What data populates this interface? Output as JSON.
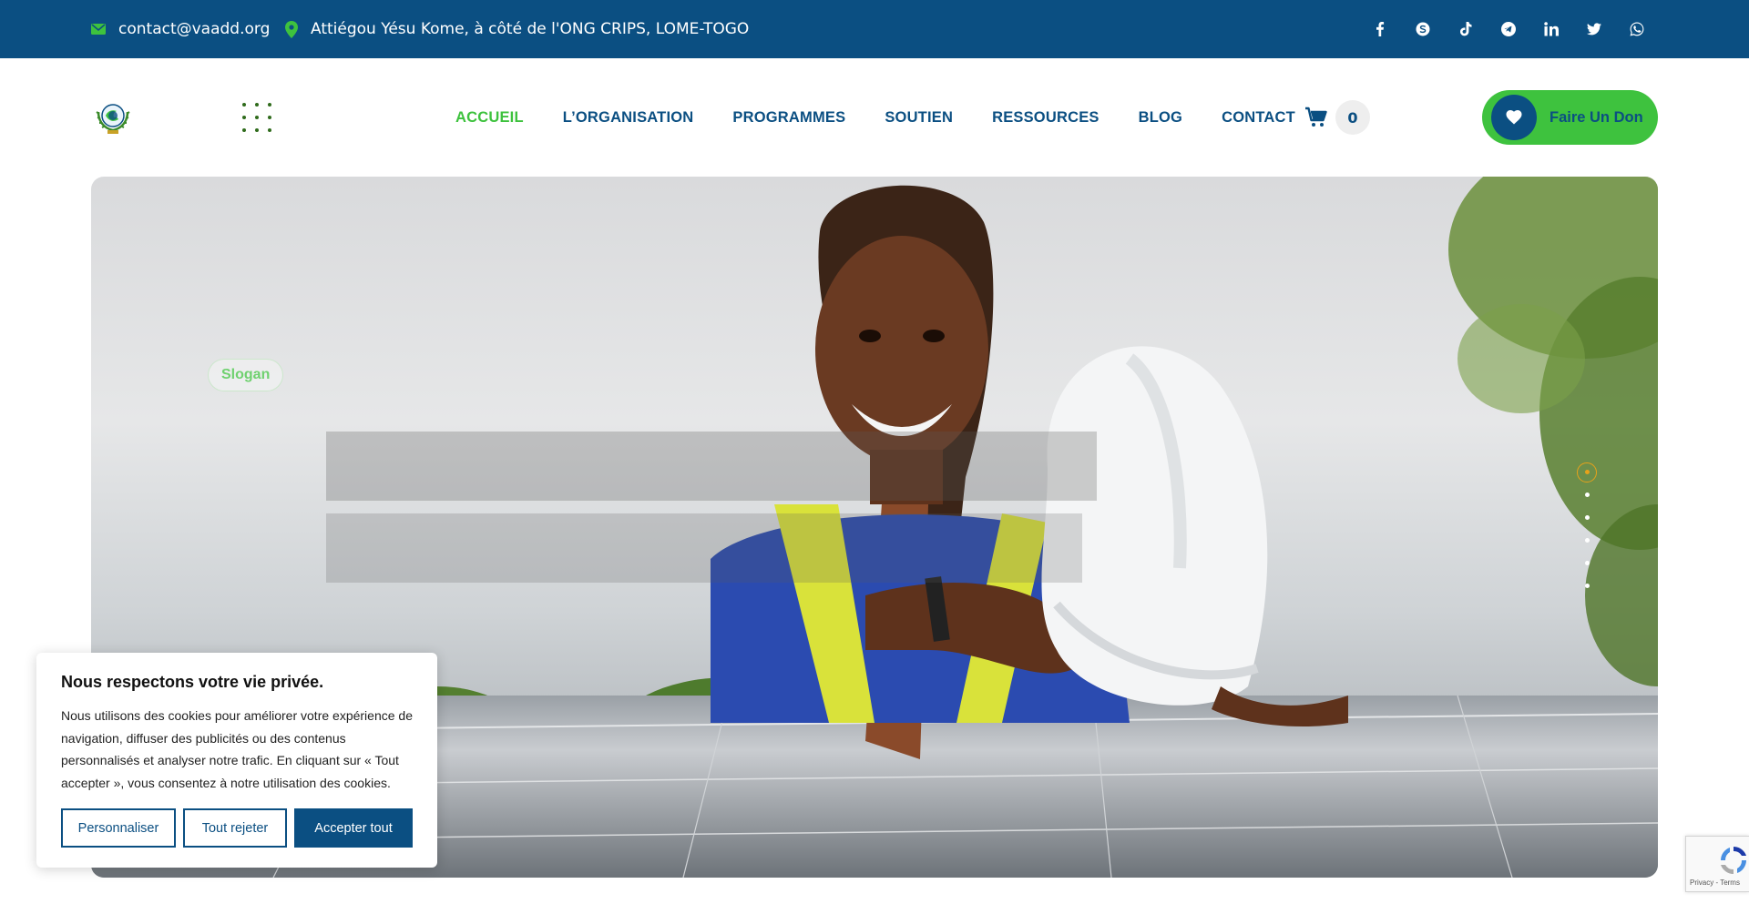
{
  "topbar": {
    "email": "contact@vaadd.org",
    "address": "Attiégou Yésu Kome, à côté de l'ONG CRIPS, LOME-TOGO",
    "socials": [
      "facebook-icon",
      "skype-icon",
      "tiktok-icon",
      "telegram-icon",
      "linkedin-icon",
      "twitter-icon",
      "whatsapp-icon"
    ]
  },
  "header": {
    "nav": [
      "ACCUEIL",
      "L’ORGANISATION",
      "PROGRAMMES",
      "SOUTIEN",
      "RESSOURCES",
      "BLOG",
      "CONTACT"
    ],
    "active_nav": "ACCUEIL",
    "cart_count": "0",
    "donate_label": "Faire Un Don"
  },
  "hero": {
    "slogan": "Slogan",
    "slides": 6,
    "active_slide": 1
  },
  "cookie": {
    "title": "Nous respectons votre vie privée.",
    "text": "Nous utilisons des cookies pour améliorer votre expérience de navigation, diffuser des publicités ou des contenus personnalisés et analyser notre trafic. En cliquant sur « Tout accepter », vous consentez à notre utilisation des cookies.",
    "btn_customize": "Personnaliser",
    "btn_reject": "Tout rejeter",
    "btn_accept": "Accepter tout"
  },
  "recaptcha": {
    "text": "Privacy - Terms"
  },
  "colors": {
    "primary": "#0b4f82",
    "accent": "#3ec23e",
    "slide_active": "#e7a21a"
  }
}
